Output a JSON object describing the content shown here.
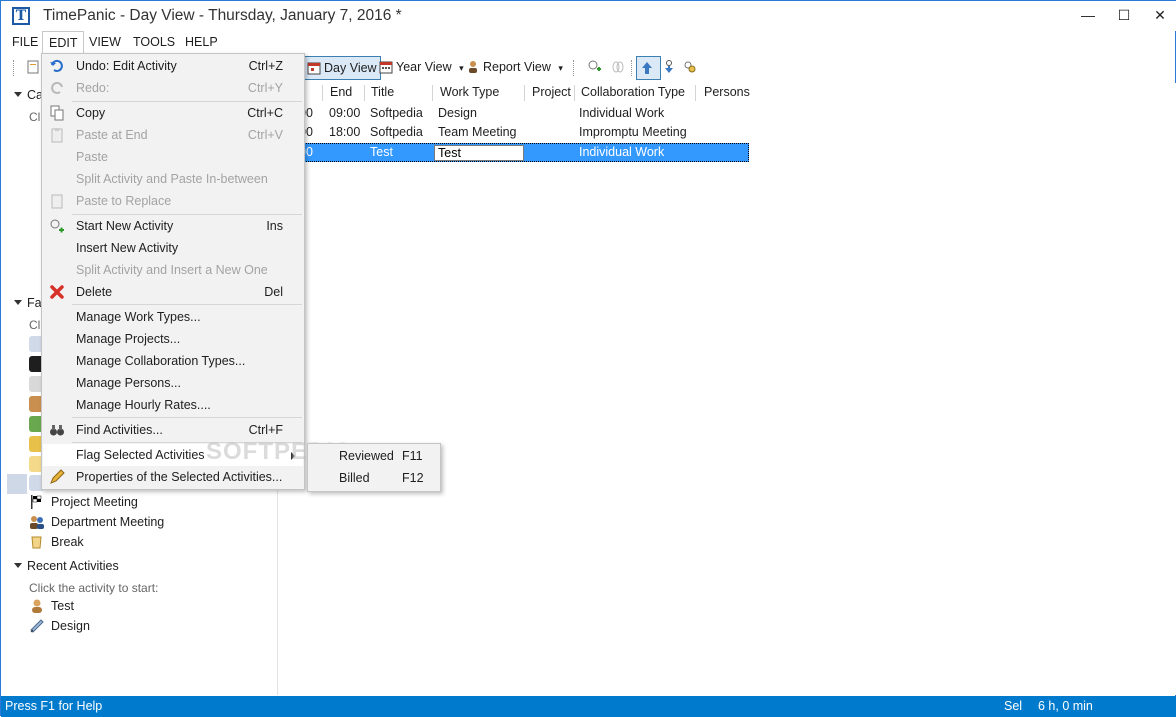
{
  "window": {
    "title": "TimePanic - Day View - Thursday, January 7, 2016 *",
    "app_icon_letter": "T",
    "controls": {
      "minimize": "—",
      "maximize": "☐",
      "close": "✕"
    }
  },
  "menubar": {
    "items": [
      {
        "label": "FILE"
      },
      {
        "label": "EDIT"
      },
      {
        "label": "VIEW"
      },
      {
        "label": "TOOLS"
      },
      {
        "label": "HELP"
      }
    ]
  },
  "toolbar": {
    "day_view": "Day View",
    "year_view": "Year View",
    "report_view": "Report View",
    "dropdown_glyph": "▾"
  },
  "left_pane": {
    "section_calendar": "Ca",
    "calendar_hint": "Cl",
    "section_favorites": "Fa",
    "favorites_hint": "Cl",
    "favorites": [
      {
        "label": "Project Meeting",
        "icon": "checkered-flag-icon"
      },
      {
        "label": "Department Meeting",
        "icon": "people-icon"
      },
      {
        "label": "Break",
        "icon": "cup-icon"
      }
    ],
    "section_recent": "Recent Activities",
    "recent_hint": "Click the activity to start:",
    "recent": [
      {
        "label": "Test",
        "icon": "person-icon"
      },
      {
        "label": "Design",
        "icon": "pencil-ruler-icon"
      }
    ]
  },
  "grid": {
    "columns": [
      "rt",
      "End",
      "Title",
      "Work Type",
      "Project",
      "Collaboration Type",
      "Persons"
    ],
    "rows": [
      {
        "start": "00",
        "end": "09:00",
        "title": "Softpedia",
        "work_type": "Design",
        "project": "",
        "collab": "Individual Work",
        "persons": ""
      },
      {
        "start": "00",
        "end": "18:00",
        "title": "Softpedia",
        "work_type": "Team Meeting",
        "project": "",
        "collab": "Impromptu Meeting",
        "persons": ""
      },
      {
        "start": "00",
        "end": "",
        "title": "Test",
        "work_type": "Test",
        "project": "",
        "collab": "Individual Work",
        "persons": ""
      }
    ]
  },
  "edit_menu": {
    "items": [
      {
        "label": "Undo: Edit Activity",
        "shortcut": "Ctrl+Z",
        "disabled": false
      },
      {
        "label": "Redo:",
        "shortcut": "Ctrl+Y",
        "disabled": true
      },
      {
        "label": "Copy",
        "shortcut": "Ctrl+C",
        "disabled": false
      },
      {
        "label": "Paste at End",
        "shortcut": "Ctrl+V",
        "disabled": true
      },
      {
        "label": "Paste",
        "shortcut": "",
        "disabled": true
      },
      {
        "label": "Split Activity and Paste In-between",
        "shortcut": "",
        "disabled": true
      },
      {
        "label": "Paste to Replace",
        "shortcut": "",
        "disabled": true
      },
      {
        "label": "Start New Activity",
        "shortcut": "Ins",
        "disabled": false
      },
      {
        "label": "Insert New Activity",
        "shortcut": "",
        "disabled": false
      },
      {
        "label": "Split Activity and Insert a New One",
        "shortcut": "",
        "disabled": true
      },
      {
        "label": "Delete",
        "shortcut": "Del",
        "disabled": false
      },
      {
        "label": "Manage Work Types...",
        "shortcut": "",
        "disabled": false
      },
      {
        "label": "Manage Projects...",
        "shortcut": "",
        "disabled": false
      },
      {
        "label": "Manage Collaboration Types...",
        "shortcut": "",
        "disabled": false
      },
      {
        "label": "Manage Persons...",
        "shortcut": "",
        "disabled": false
      },
      {
        "label": "Manage Hourly Rates....",
        "shortcut": "",
        "disabled": false
      },
      {
        "label": "Find Activities...",
        "shortcut": "Ctrl+F",
        "disabled": false
      },
      {
        "label": "Flag Selected Activities",
        "shortcut": "",
        "disabled": false
      },
      {
        "label": "Properties of the Selected Activities...",
        "shortcut": "",
        "disabled": false
      }
    ]
  },
  "flag_submenu": {
    "items": [
      {
        "label": "Reviewed",
        "shortcut": "F11"
      },
      {
        "label": "Billed",
        "shortcut": "F12"
      }
    ]
  },
  "watermark": "SOFTPEDIA",
  "status": {
    "help": "Press F1 for Help",
    "sel": "Sel",
    "duration": "6 h, 0 min"
  },
  "colors": {
    "accent": "#007acc",
    "selection": "#3399ff"
  }
}
